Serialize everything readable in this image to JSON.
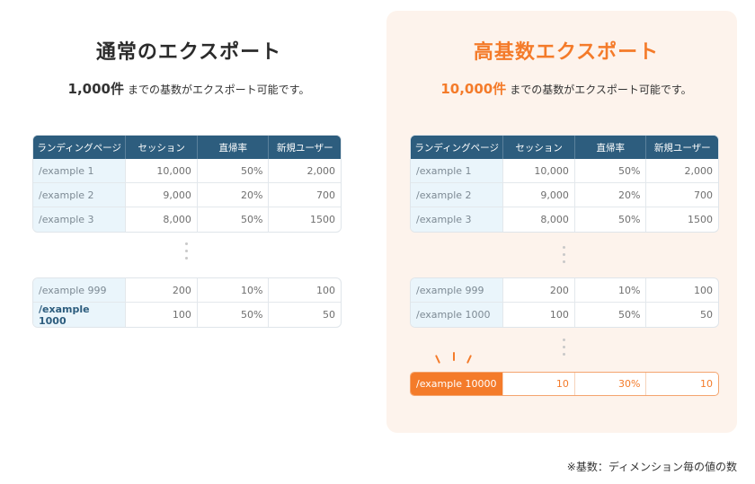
{
  "left": {
    "title": "通常のエクスポート",
    "subtitle_count": "1,000件",
    "subtitle_text": "までの基数がエクスポート可能です。"
  },
  "right": {
    "title": "高基数エクスポート",
    "subtitle_count": "10,000件",
    "subtitle_text": "までの基数がエクスポート可能です。"
  },
  "table": {
    "headers": [
      "ランディングページ",
      "セッション",
      "直帰率",
      "新規ユーザー"
    ],
    "top_rows": [
      [
        "/example 1",
        "10,000",
        "50%",
        "2,000"
      ],
      [
        "/example 2",
        "9,000",
        "20%",
        "700"
      ],
      [
        "/example 3",
        "8,000",
        "50%",
        "1500"
      ]
    ],
    "bottom_rows": [
      [
        "/example 999",
        "200",
        "10%",
        "100"
      ],
      [
        "/example 1000",
        "100",
        "50%",
        "50"
      ]
    ],
    "highlight_row": [
      "/example 10000",
      "10",
      "30%",
      "10"
    ]
  },
  "footnote": "※基数：ディメンション毎の値の数",
  "colors": {
    "header": "#2d5d7e",
    "accent": "#f47b2a",
    "right_background": "#fdf3ec"
  }
}
